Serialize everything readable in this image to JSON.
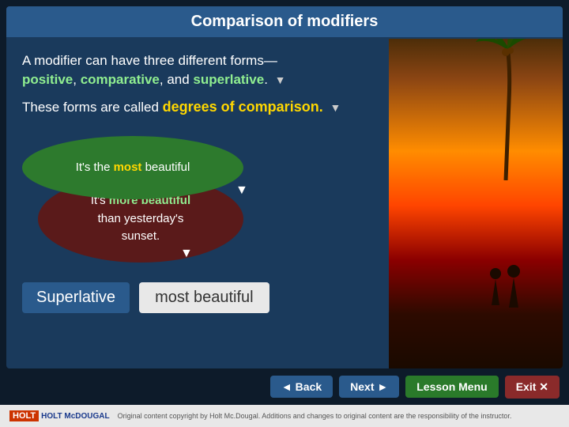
{
  "page": {
    "title": "Comparison of modifiers",
    "intro_line1": "A modifier can have three different forms—",
    "intro_line2_part1": "positive",
    "intro_line2_sep1": ", ",
    "intro_line2_part2": "comparative",
    "intro_line2_sep2": ", and ",
    "intro_line2_part3": "superlative",
    "intro_line2_end": ".",
    "degrees_prefix": "These forms are called ",
    "degrees_highlight": "degrees of comparison.",
    "bubble_green_prefix": "It's the ",
    "bubble_green_highlight": "most",
    "bubble_green_suffix": " beautiful",
    "bubble_dark_line1_prefix": "It's ",
    "bubble_dark_line1_more": "more",
    "bubble_dark_line1_suffix": " ",
    "bubble_dark_beautiful": "beautiful",
    "bubble_dark_line2": "than yesterday's",
    "bubble_dark_line3": "sunset.",
    "superlative_label": "Superlative",
    "superlative_value": "most beautiful"
  },
  "nav": {
    "back_label": "◄ Back",
    "next_label": "Next ►",
    "lesson_menu_label": "Lesson Menu",
    "exit_label": "Exit ✕"
  },
  "footer": {
    "brand": "HOLT McDOUGAL",
    "copyright": "Original content copyright by Holt Mc.Dougal. Additions and changes to original content are the responsibility of the instructor."
  },
  "colors": {
    "accent_gold": "#FFD700",
    "accent_green": "#90EE90",
    "bg_blue": "#1a3a5c",
    "title_blue": "#2a5a8c"
  }
}
